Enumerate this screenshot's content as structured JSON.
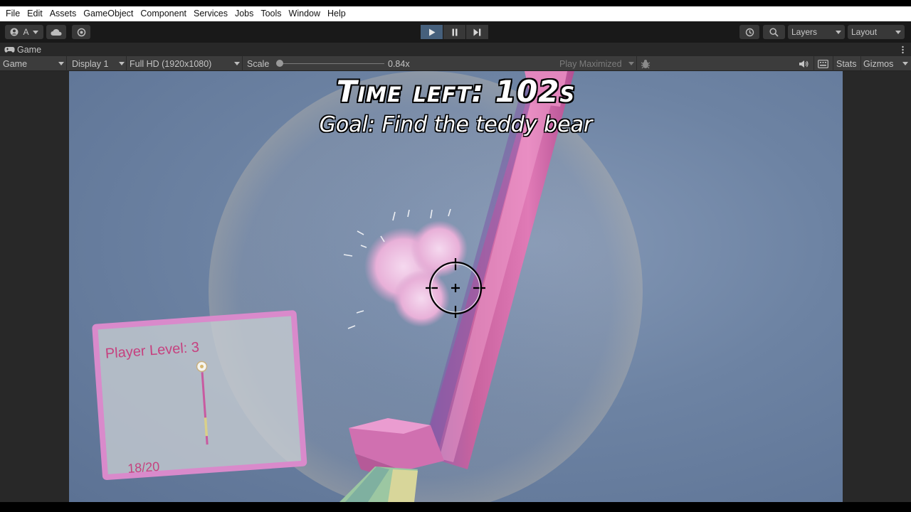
{
  "menu": [
    "File",
    "Edit",
    "Assets",
    "GameObject",
    "Component",
    "Services",
    "Jobs",
    "Tools",
    "Window",
    "Help"
  ],
  "toolbar": {
    "account_label": "A",
    "layers_label": "Layers",
    "layout_label": "Layout"
  },
  "game_tab": {
    "label": "Game"
  },
  "game_controls": {
    "mode": "Game",
    "display": "Display 1",
    "resolution": "Full HD (1920x1080)",
    "scale_label": "Scale",
    "scale_value": "0.84x",
    "play_maximized": "Play Maximized",
    "stats_label": "Stats",
    "gizmos_label": "Gizmos"
  },
  "hud": {
    "time_left": "Time left: 102s",
    "goal": "Goal: Find the teddy bear"
  },
  "level_card": {
    "level": "Player Level: 3",
    "progress": "18/20"
  },
  "colors": {
    "sky": "#6d83a3",
    "wand": "#d86aa8",
    "card_border": "#d98acb",
    "card_text": "#c6417f",
    "play_active": "#46607c"
  }
}
